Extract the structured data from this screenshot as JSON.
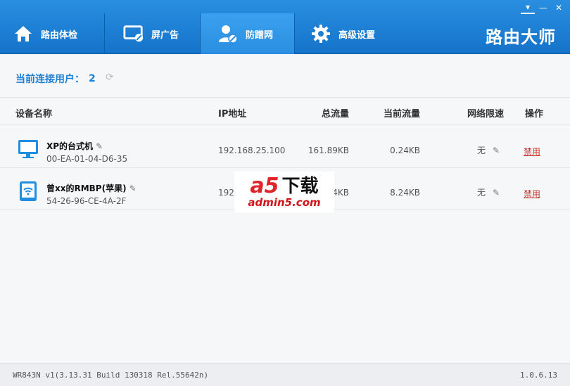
{
  "window": {
    "controls": {
      "menu": "▾",
      "minimize": "—",
      "close": "✕"
    }
  },
  "nav": {
    "tabs": [
      {
        "label": "路由体检",
        "icon": "home-icon"
      },
      {
        "label": "屏广告",
        "icon": "monitor-block-icon"
      },
      {
        "label": "防蹭网",
        "icon": "user-block-icon",
        "active": true
      },
      {
        "label": "高级设置",
        "icon": "gear-icon"
      }
    ],
    "brand": "路由大师"
  },
  "users": {
    "label": "当前连接用户：",
    "count": "2"
  },
  "table": {
    "headers": {
      "device": "设备名称",
      "ip": "IP地址",
      "total": "总流量",
      "current": "当前流量",
      "limit": "网络限速",
      "action": "操作"
    },
    "rows": [
      {
        "name": "XP的台式机",
        "mac": "00-EA-01-04-D6-35",
        "ip": "192.168.25.100",
        "total": "161.89KB",
        "current": "0.24KB",
        "limit": "无",
        "action": "禁用",
        "icon": "desktop-icon"
      },
      {
        "name": "曾xx的RMBP(苹果)",
        "mac": "54-26-96-CE-4A-2F",
        "ip": "192",
        "total": "4KB",
        "current": "8.24KB",
        "limit": "无",
        "action": "禁用",
        "icon": "wifi-tablet-icon"
      }
    ]
  },
  "watermark": {
    "mark": "a5",
    "text": "下载",
    "url": "admin5.com"
  },
  "status": {
    "left": "WR843N v1(3.13.31 Build 130318 Rel.55642n)",
    "right": "1.0.6.13"
  },
  "colors": {
    "header": "#1d7fd5",
    "accent": "#1d7fd5",
    "action": "#c8332f"
  }
}
